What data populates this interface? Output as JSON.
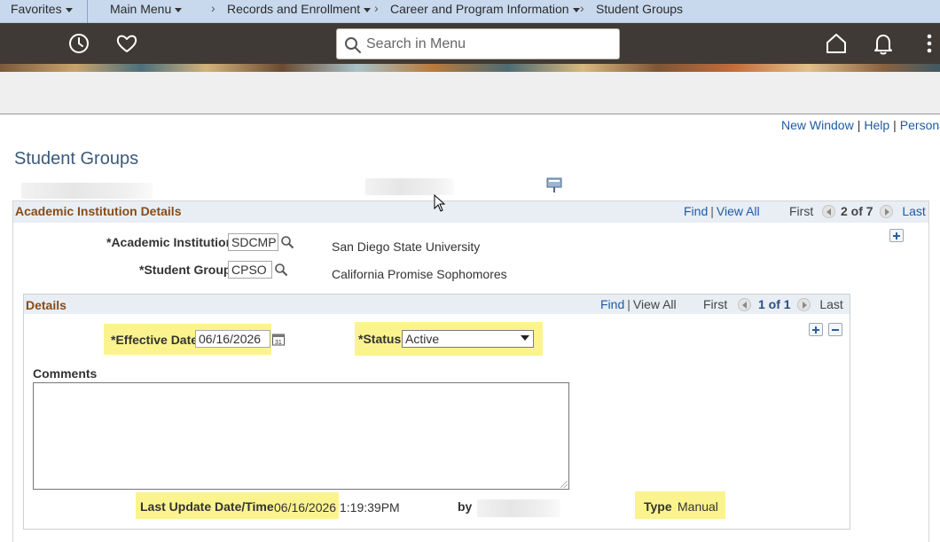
{
  "breadcrumb": {
    "favorites": "Favorites",
    "main_menu": "Main Menu",
    "records": "Records and Enrollment",
    "career": "Career and Program Information",
    "current": "Student Groups",
    "separator": "›"
  },
  "header": {
    "search_placeholder": "Search in Menu",
    "icons": [
      "history-icon",
      "favorites-heart-icon",
      "search-icon",
      "home-icon",
      "notifications-bell-icon",
      "more-vertical-icon"
    ]
  },
  "top_links": {
    "new_window": "New Window",
    "help": "Help",
    "personalize": "Persona"
  },
  "page_title": "Student Groups",
  "institution_panel": {
    "title": "Academic Institution Details",
    "find": "Find",
    "view_all": "View All",
    "first": "First",
    "counter": "2 of 7",
    "last": "Last",
    "academic_institution_label": "*Academic Institution",
    "academic_institution_value": "SDCMP",
    "academic_institution_desc": "San Diego State University",
    "student_group_label": "*Student Group",
    "student_group_value": "CPSO",
    "student_group_desc": "California Promise Sophomores"
  },
  "details_panel": {
    "title": "Details",
    "find": "Find",
    "view_all": "View All",
    "first": "First",
    "counter": "1 of 1",
    "last": "Last",
    "effective_date_label": "*Effective Date",
    "effective_date_value": "06/16/2026",
    "status_label": "*Status",
    "status_value": "Active",
    "comments_label": "Comments",
    "comments_value": "",
    "last_update_label": "Last Update Date/Time",
    "last_update_date": "06/16/2026",
    "last_update_time": "1:19:39PM",
    "by_label": "by",
    "type_label": "Type",
    "type_value": "Manual"
  },
  "colors": {
    "breadcrumb_bg": "#c8d9ee",
    "header_bg": "#3f3a35",
    "section_title": "#8a4b16",
    "link": "#1f5aa6",
    "highlight": "#fbf48e"
  }
}
